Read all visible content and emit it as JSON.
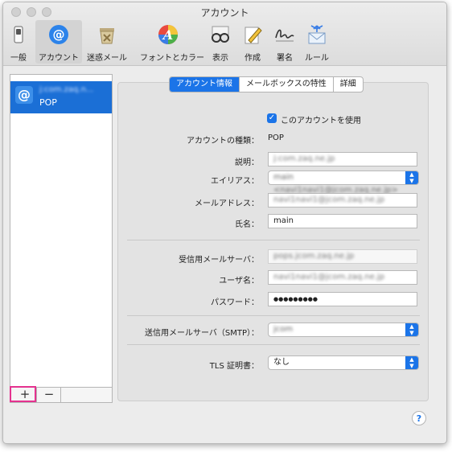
{
  "window": {
    "title": "アカウント"
  },
  "toolbar": {
    "items": [
      {
        "label": "一般",
        "icon": "switch-icon"
      },
      {
        "label": "アカウント",
        "icon": "at-icon"
      },
      {
        "label": "迷惑メール",
        "icon": "junk-trash-icon"
      },
      {
        "label": "フォントとカラー",
        "icon": "font-color-icon"
      },
      {
        "label": "表示",
        "icon": "glasses-icon"
      },
      {
        "label": "作成",
        "icon": "pencil-note-icon"
      },
      {
        "label": "署名",
        "icon": "signature-icon"
      },
      {
        "label": "ルール",
        "icon": "rules-envelope-icon"
      }
    ]
  },
  "sidebar": {
    "account": {
      "name": "j:com.zaq.n...",
      "type": "POP"
    },
    "add_label": "+",
    "remove_label": "−"
  },
  "tabs": [
    {
      "label": "アカウント情報",
      "active": true
    },
    {
      "label": "メールボックスの特性",
      "active": false
    },
    {
      "label": "詳細",
      "active": false
    }
  ],
  "form": {
    "enable_label": "このアカウントを使用",
    "account_type_label": "アカウントの種類：",
    "account_type_value": "POP",
    "description_label": "説明：",
    "description_value": "j:com.zaq.ne.jp",
    "alias_label": "エイリアス：",
    "alias_value": "main <navi1navi1@jcom.zaq.ne.jp>",
    "email_label": "メールアドレス：",
    "email_value": "navi1navi1@jcom.zaq.ne.jp",
    "name_label": "氏名：",
    "name_value": "main",
    "incoming_label": "受信用メールサーバ：",
    "incoming_value": "pops.jcom.zaq.ne.jp",
    "username_label": "ユーザ名：",
    "username_value": "navi1navi1@jcom.zaq.ne.jp",
    "password_label": "パスワード：",
    "password_value": "●●●●●●●●●",
    "smtp_label": "送信用メールサーバ（SMTP）：",
    "smtp_value": "jcom",
    "tls_label": "TLS 証明書：",
    "tls_value": "なし"
  },
  "help_label": "?",
  "colors": {
    "accent": "#1b74e8",
    "highlight": "#e4328f"
  }
}
